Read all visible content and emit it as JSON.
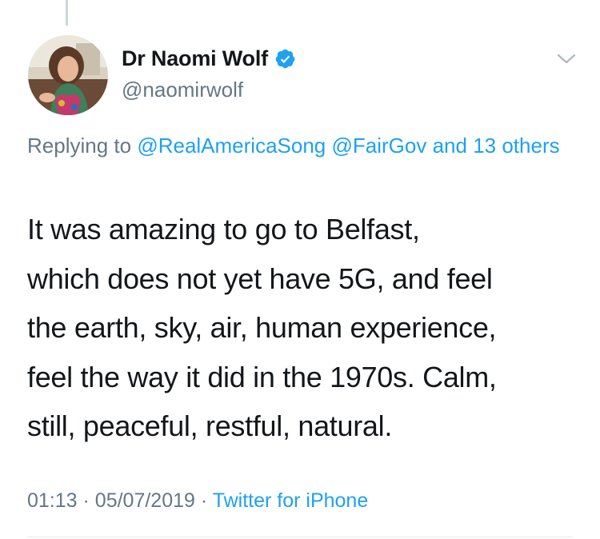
{
  "tweet": {
    "author": {
      "display_name": "Dr Naomi Wolf",
      "handle": "@naomirwolf",
      "verified": true,
      "avatar": "profile-photo"
    },
    "reply": {
      "prefix": "Replying to",
      "mention_1": "@RealAmericaSong",
      "mention_2": "@FairGov",
      "others": "and 13 others"
    },
    "text_lines": [
      "It was amazing to go to Belfast,",
      "which does not yet have 5G, and feel",
      "the earth, sky, air, human experience,",
      "feel the way it did in the 1970s. Calm,",
      "still, peaceful, restful, natural."
    ],
    "time": "01:13",
    "separator": "·",
    "date": "05/07/2019",
    "source": "Twitter for iPhone"
  },
  "colors": {
    "link": "#1da1f2",
    "secondary_text": "#657786",
    "primary_text": "#14171a",
    "verified_badge": "#1da1f2"
  }
}
